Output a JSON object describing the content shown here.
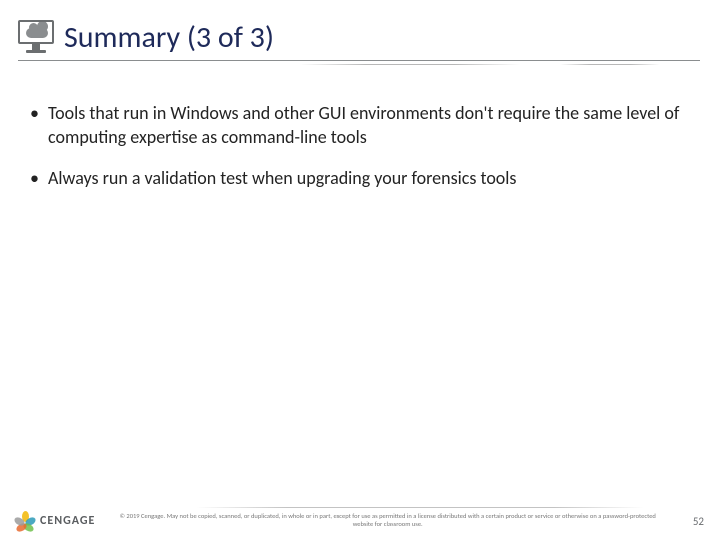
{
  "header": {
    "title": "Summary (3 of 3)"
  },
  "body": {
    "bullets": [
      "Tools that run in Windows and other GUI environments don't require the same level of computing expertise as command-line tools",
      "Always run a validation test when upgrading your forensics tools"
    ]
  },
  "footer": {
    "brand": "CENGAGE",
    "copyright": "© 2019 Cengage. May not be copied, scanned, or duplicated, in whole or in part, except for use as permitted in a license distributed with a certain product or service or otherwise on a password-protected website for classroom use.",
    "page_number": "52"
  }
}
